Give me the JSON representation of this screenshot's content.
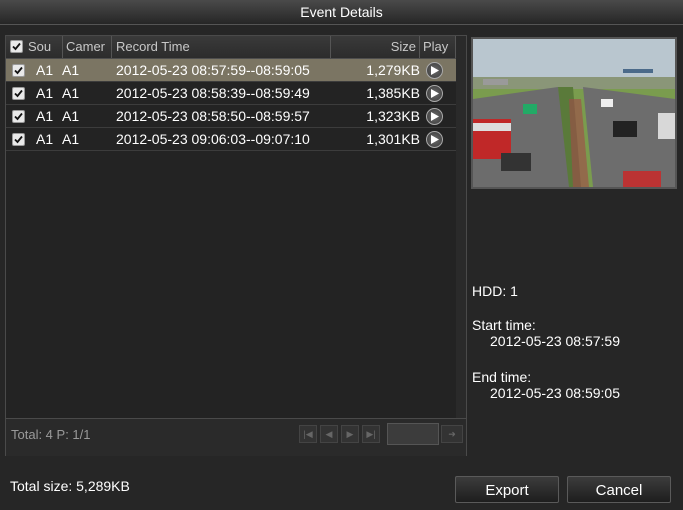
{
  "window": {
    "title": "Event Details"
  },
  "table": {
    "columns": [
      "Sou",
      "Camer",
      "Record Time",
      "Size",
      "Play"
    ],
    "rows": [
      {
        "source": "A1",
        "camera": "A1",
        "time": "2012-05-23 08:57:59--08:59:05",
        "size": "1,279KB",
        "selected": true
      },
      {
        "source": "A1",
        "camera": "A1",
        "time": "2012-05-23 08:58:39--08:59:49",
        "size": "1,385KB",
        "selected": false
      },
      {
        "source": "A1",
        "camera": "A1",
        "time": "2012-05-23 08:58:50--08:59:57",
        "size": "1,323KB",
        "selected": false
      },
      {
        "source": "A1",
        "camera": "A1",
        "time": "2012-05-23 09:06:03--09:07:10",
        "size": "1,301KB",
        "selected": false
      }
    ],
    "footer": "Total: 4  P: 1/1"
  },
  "details": {
    "hdd": "HDD: 1",
    "start_label": "Start time:",
    "start_value": "2012-05-23 08:57:59",
    "end_label": "End time:",
    "end_value": "2012-05-23 08:59:05"
  },
  "bottom": {
    "total_size": "Total size: 5,289KB"
  },
  "buttons": {
    "export": "Export",
    "cancel": "Cancel"
  },
  "icons": {
    "checkbox": "checkbox-checked-icon",
    "play": "play-icon",
    "pager": [
      "first-page-icon",
      "prev-page-icon",
      "next-page-icon",
      "last-page-icon",
      "go-page-icon"
    ]
  },
  "colors": {
    "selected_row": "#7b7563",
    "background": "#262626"
  }
}
